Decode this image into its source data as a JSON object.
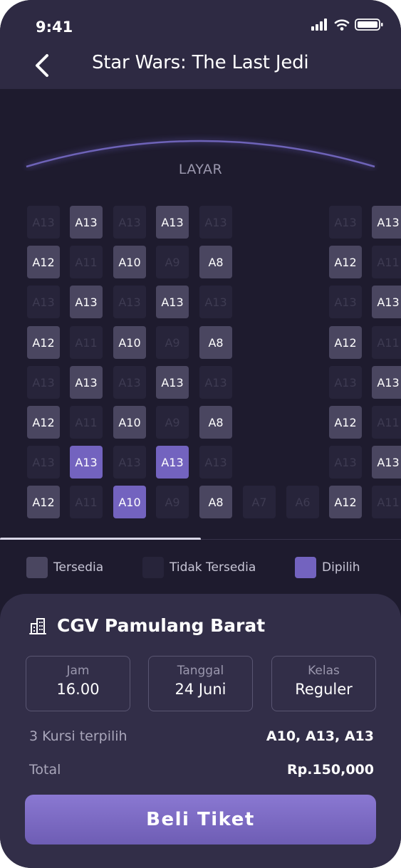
{
  "status_bar": {
    "time": "9:41"
  },
  "header": {
    "title": "Star Wars: The Last Jedi"
  },
  "screen": {
    "label": "LAYAR"
  },
  "seat_rows": [
    [
      {
        "label": "A13",
        "state": "unavailable"
      },
      {
        "label": "A13",
        "state": "available"
      },
      {
        "label": "A13",
        "state": "unavailable"
      },
      {
        "label": "A13",
        "state": "available"
      },
      {
        "label": "A13",
        "state": "unavailable"
      },
      null,
      null,
      {
        "label": "A13",
        "state": "unavailable"
      },
      {
        "label": "A13",
        "state": "available"
      }
    ],
    [
      {
        "label": "A12",
        "state": "available"
      },
      {
        "label": "A11",
        "state": "unavailable"
      },
      {
        "label": "A10",
        "state": "available"
      },
      {
        "label": "A9",
        "state": "unavailable"
      },
      {
        "label": "A8",
        "state": "available"
      },
      null,
      null,
      {
        "label": "A12",
        "state": "available"
      },
      {
        "label": "A11",
        "state": "unavailable"
      }
    ],
    [
      {
        "label": "A13",
        "state": "unavailable"
      },
      {
        "label": "A13",
        "state": "available"
      },
      {
        "label": "A13",
        "state": "unavailable"
      },
      {
        "label": "A13",
        "state": "available"
      },
      {
        "label": "A13",
        "state": "unavailable"
      },
      null,
      null,
      {
        "label": "A13",
        "state": "unavailable"
      },
      {
        "label": "A13",
        "state": "available"
      }
    ],
    [
      {
        "label": "A12",
        "state": "available"
      },
      {
        "label": "A11",
        "state": "unavailable"
      },
      {
        "label": "A10",
        "state": "available"
      },
      {
        "label": "A9",
        "state": "unavailable"
      },
      {
        "label": "A8",
        "state": "available"
      },
      null,
      null,
      {
        "label": "A12",
        "state": "available"
      },
      {
        "label": "A11",
        "state": "unavailable"
      }
    ],
    [
      {
        "label": "A13",
        "state": "unavailable"
      },
      {
        "label": "A13",
        "state": "available"
      },
      {
        "label": "A13",
        "state": "unavailable"
      },
      {
        "label": "A13",
        "state": "available"
      },
      {
        "label": "A13",
        "state": "unavailable"
      },
      null,
      null,
      {
        "label": "A13",
        "state": "unavailable"
      },
      {
        "label": "A13",
        "state": "available"
      }
    ],
    [
      {
        "label": "A12",
        "state": "available"
      },
      {
        "label": "A11",
        "state": "unavailable"
      },
      {
        "label": "A10",
        "state": "available"
      },
      {
        "label": "A9",
        "state": "unavailable"
      },
      {
        "label": "A8",
        "state": "available"
      },
      null,
      null,
      {
        "label": "A12",
        "state": "available"
      },
      {
        "label": "A11",
        "state": "unavailable"
      }
    ],
    [
      {
        "label": "A13",
        "state": "unavailable"
      },
      {
        "label": "A13",
        "state": "selected"
      },
      {
        "label": "A13",
        "state": "unavailable"
      },
      {
        "label": "A13",
        "state": "selected"
      },
      {
        "label": "A13",
        "state": "unavailable"
      },
      null,
      null,
      {
        "label": "A13",
        "state": "unavailable"
      },
      {
        "label": "A13",
        "state": "available"
      }
    ],
    [
      {
        "label": "A12",
        "state": "available"
      },
      {
        "label": "A11",
        "state": "unavailable"
      },
      {
        "label": "A10",
        "state": "selected"
      },
      {
        "label": "A9",
        "state": "unavailable"
      },
      {
        "label": "A8",
        "state": "available"
      },
      {
        "label": "A7",
        "state": "unavailable"
      },
      {
        "label": "A6",
        "state": "unavailable"
      },
      {
        "label": "A12",
        "state": "available"
      },
      {
        "label": "A11",
        "state": "unavailable"
      }
    ]
  ],
  "legend": {
    "available": "Tersedia",
    "unavailable": "Tidak Tersedia",
    "selected": "Dipilih"
  },
  "colors": {
    "available": "#4a4660",
    "unavailable": "#27243a",
    "selected": "#7363bf"
  },
  "booking": {
    "cinema_name": "CGV Pamulang Barat",
    "time_label": "Jam",
    "time_value": "16.00",
    "date_label": "Tanggal",
    "date_value": "24 Juni",
    "class_label": "Kelas",
    "class_value": "Reguler",
    "seats_label": "3 Kursi terpilih",
    "seats_value": "A10, A13, A13",
    "total_label": "Total",
    "total_value": "Rp.150,000",
    "buy_button": "Beli Tiket"
  }
}
